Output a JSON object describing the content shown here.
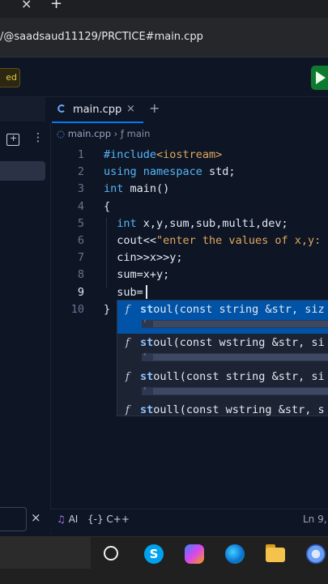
{
  "browser": {
    "tab_close": "×",
    "tab_new": "+",
    "url": "/@saadsaud11129/PRCTICE#main.cpp"
  },
  "header": {
    "status_chip": "ed",
    "run_icon": "play-icon"
  },
  "editor": {
    "tab": {
      "label": "main.cpp",
      "close": "×"
    },
    "add_tab": "+",
    "breadcrumb": {
      "file": "main.cpp",
      "sep": "›",
      "func_icon": "ƒ",
      "func": "main"
    },
    "lines": [
      {
        "n": "1",
        "parts": [
          [
            "pre",
            "#include"
          ],
          [
            "str",
            "<iostream>"
          ]
        ]
      },
      {
        "n": "2",
        "parts": [
          [
            "kw",
            "using namespace"
          ],
          [
            "txt",
            " std;"
          ]
        ]
      },
      {
        "n": "3",
        "parts": [
          [
            "kw",
            "int"
          ],
          [
            "txt",
            " main()"
          ]
        ]
      },
      {
        "n": "4",
        "parts": [
          [
            "txt",
            "{"
          ]
        ]
      },
      {
        "n": "5",
        "parts": [
          [
            "txt",
            "  "
          ],
          [
            "kw",
            "int"
          ],
          [
            "txt",
            " x,y,sum,sub,multi,dev;"
          ]
        ]
      },
      {
        "n": "6",
        "parts": [
          [
            "txt",
            "  cout<<"
          ],
          [
            "str",
            "\"enter the values of x,y:"
          ]
        ]
      },
      {
        "n": "7",
        "parts": [
          [
            "txt",
            "  cin>>x>>y;"
          ]
        ]
      },
      {
        "n": "8",
        "parts": [
          [
            "txt",
            "  sum=x+y;"
          ]
        ]
      },
      {
        "n": "9",
        "parts": [
          [
            "txt",
            "  sub="
          ]
        ]
      },
      {
        "n": "10",
        "parts": [
          [
            "txt",
            "}"
          ]
        ]
      }
    ],
    "active_line": "9"
  },
  "autocomplete": {
    "items": [
      {
        "kind": "f",
        "match": "st",
        "rest": "oul(const string &str, siz",
        "selected": true
      },
      {
        "kind": "f",
        "match": "st",
        "rest": "oul(const wstring &str, si",
        "selected": false
      },
      {
        "kind": "f",
        "match": "st",
        "rest": "oull(const string &str, si",
        "selected": false
      },
      {
        "kind": "f",
        "match": "st",
        "rest": "oull(const wstring &str, s",
        "selected": false
      }
    ]
  },
  "statusbar": {
    "ai": "AI",
    "lang": "{-} C++",
    "position": "Ln 9,"
  },
  "filetree": {
    "close": "×",
    "kebab": "⋮"
  },
  "taskbar": {
    "skype_letter": "S"
  }
}
